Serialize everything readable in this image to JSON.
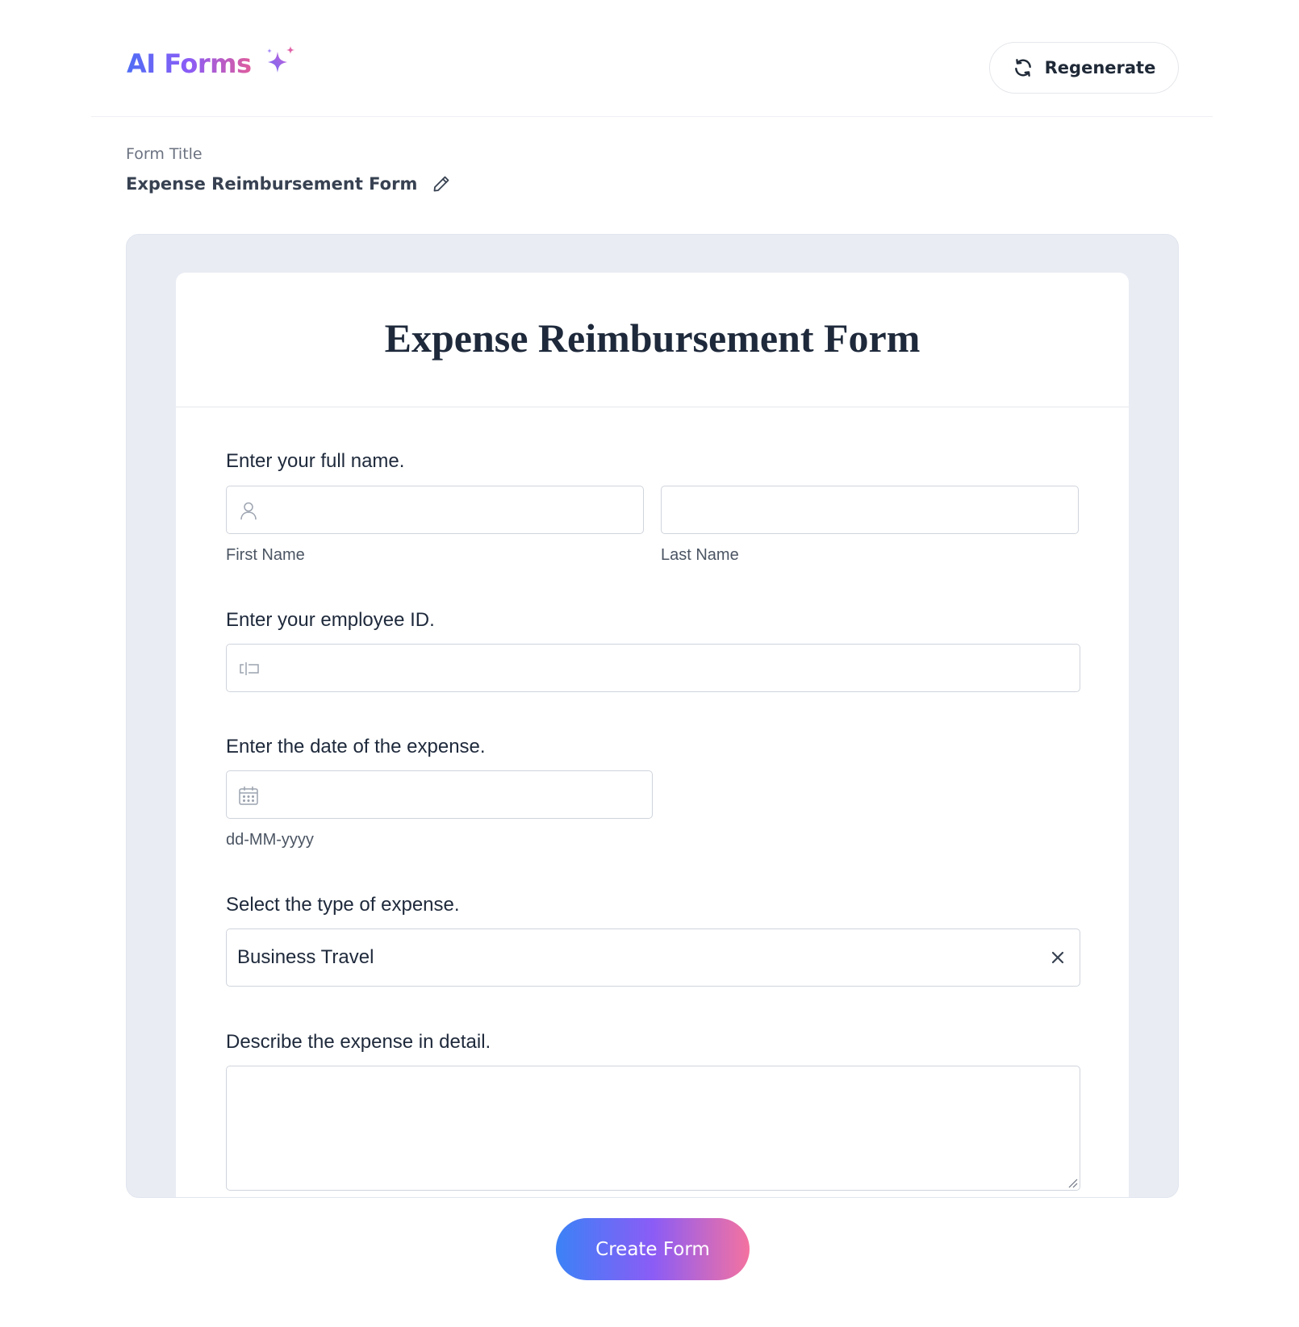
{
  "app": {
    "logo_text": "AI Forms",
    "regenerate_label": "Regenerate"
  },
  "editor": {
    "title_label": "Form Title",
    "title_value": "Expense Reimbursement Form"
  },
  "form": {
    "heading": "Expense Reimbursement Form",
    "fields": [
      {
        "label": "Enter your full name.",
        "sublabels": [
          "First Name",
          "Last Name"
        ]
      },
      {
        "label": "Enter your employee ID."
      },
      {
        "label": "Enter the date of the expense.",
        "sublabel": "dd-MM-yyyy"
      },
      {
        "label": "Select the type of expense.",
        "selected": "Business Travel"
      },
      {
        "label": "Describe the expense in detail."
      }
    ]
  },
  "actions": {
    "create_label": "Create Form"
  },
  "colors": {
    "gradient_start": "#3b82f6",
    "gradient_mid": "#8b5cf6",
    "gradient_end": "#f472a0",
    "preview_bg": "#e9ecf3"
  }
}
